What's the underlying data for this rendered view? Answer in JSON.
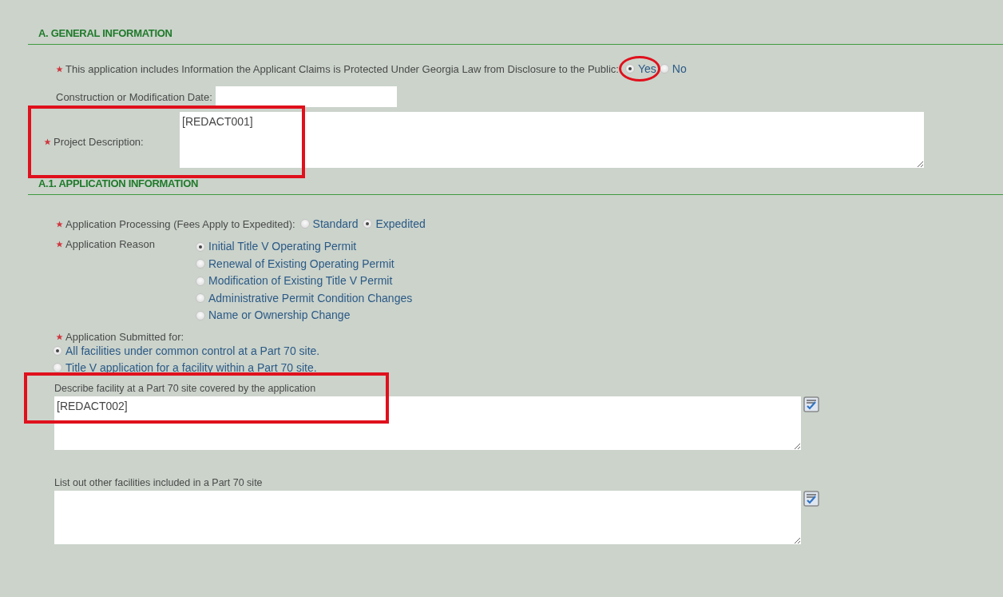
{
  "general": {
    "heading": "A. GENERAL INFORMATION",
    "confidentiality": {
      "required": true,
      "label": "This application includes Information the Applicant Claims is Protected Under Georgia Law from Disclosure to the Public:",
      "options": [
        {
          "label": "Yes",
          "selected": true
        },
        {
          "label": "No",
          "selected": false
        }
      ]
    },
    "construction_date": {
      "label": "Construction or Modification Date:"
    },
    "project_description": {
      "required": true,
      "label": "Project Description:",
      "value": "[REDACT001]"
    }
  },
  "application": {
    "heading": "A.1. APPLICATION INFORMATION",
    "processing": {
      "required": true,
      "label": "Application Processing (Fees Apply to Expedited):",
      "options": [
        {
          "label": "Standard",
          "selected": false
        },
        {
          "label": "Expedited",
          "selected": true
        }
      ]
    },
    "reason": {
      "required": true,
      "label": "Application Reason",
      "options": [
        {
          "label": "Initial Title V Operating Permit",
          "selected": true
        },
        {
          "label": "Renewal of Existing Operating Permit",
          "selected": false
        },
        {
          "label": "Modification of Existing Title V Permit",
          "selected": false
        },
        {
          "label": "Administrative Permit Condition Changes",
          "selected": false
        },
        {
          "label": "Name or Ownership Change",
          "selected": false
        }
      ]
    },
    "submitted_for": {
      "required": true,
      "label": "Application Submitted for:",
      "options": [
        {
          "label": "All facilities under common control at a Part 70 site.",
          "selected": true
        },
        {
          "label": "Title V application for a facility within a Part 70 site.",
          "selected": false
        }
      ]
    },
    "describe_facility": {
      "label": "Describe facility at a Part 70 site covered by the application",
      "value": "[REDACT002]"
    },
    "other_facilities": {
      "label": "List out other facilities included in a Part 70 site"
    }
  }
}
